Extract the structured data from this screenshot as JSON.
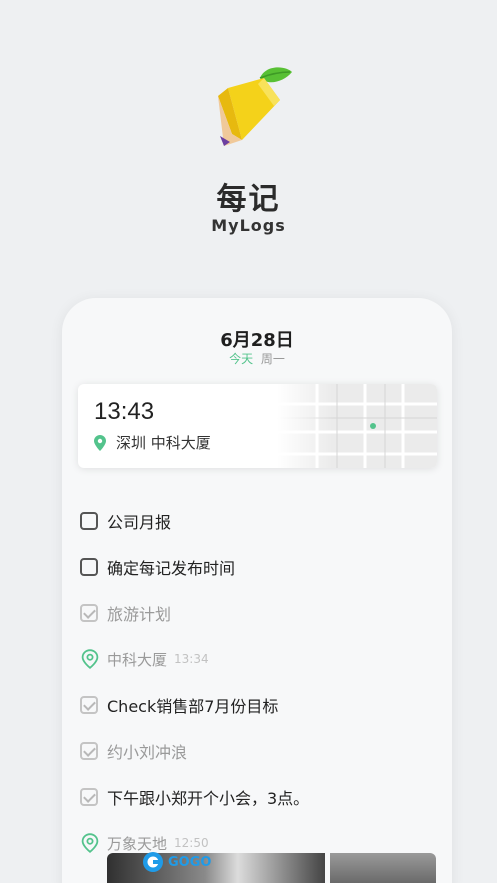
{
  "app": {
    "name": "每记",
    "subtitle": "MyLogs",
    "icon": "pencil-leaf-logo"
  },
  "card": {
    "date": "6月28日",
    "today_label": "今天",
    "weekday": "周一"
  },
  "location_card": {
    "time": "13:43",
    "place": "深圳  中科大厦",
    "icon": "location-pin-icon",
    "pin_color": "#53c38c"
  },
  "items": [
    {
      "type": "todo",
      "text": "公司月报",
      "checked": false
    },
    {
      "type": "todo",
      "text": "确定每记发布时间",
      "checked": false
    },
    {
      "type": "todo",
      "text": "旅游计划",
      "checked": true
    },
    {
      "type": "location",
      "text": "中科大厦",
      "time": "13:34"
    },
    {
      "type": "todo",
      "text": "Check销售部7月份目标",
      "checked": true
    },
    {
      "type": "todo",
      "text": "约小刘冲浪",
      "checked": true
    },
    {
      "type": "todo",
      "text": "下午跟小郑开个小会，3点。",
      "checked": true
    },
    {
      "type": "location",
      "text": "万象天地",
      "time": "12:50"
    }
  ],
  "colors": {
    "accent": "#53c38c",
    "background": "#eef0f2"
  }
}
